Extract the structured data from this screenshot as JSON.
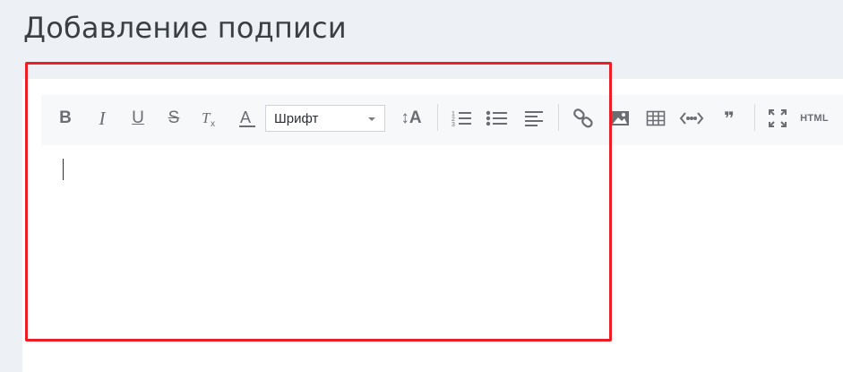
{
  "page": {
    "title": "Добавление подписи"
  },
  "toolbar": {
    "font_select": {
      "value": "Шрифт"
    },
    "html_label": "HTML",
    "bold_glyph": "B",
    "italic_glyph": "I",
    "underline_glyph": "U",
    "strike_glyph": "S",
    "size_glyph": "↕A",
    "quote_glyph": "❞",
    "buttons": [
      "bold-icon",
      "italic-icon",
      "underline-icon",
      "strikethrough-icon",
      "remove-format-icon",
      "text-color-icon",
      "font-size-icon",
      "ordered-list-icon",
      "unordered-list-icon",
      "align-left-icon",
      "link-icon",
      "image-icon",
      "table-icon",
      "code-icon",
      "quote-icon",
      "fullscreen-icon",
      "html-source-icon"
    ]
  },
  "editor": {
    "content": ""
  },
  "colors": {
    "highlight": "#ee1c24",
    "background": "#edf1f5",
    "toolbar": "#f7f8f9",
    "icon": "#6a6e73"
  }
}
